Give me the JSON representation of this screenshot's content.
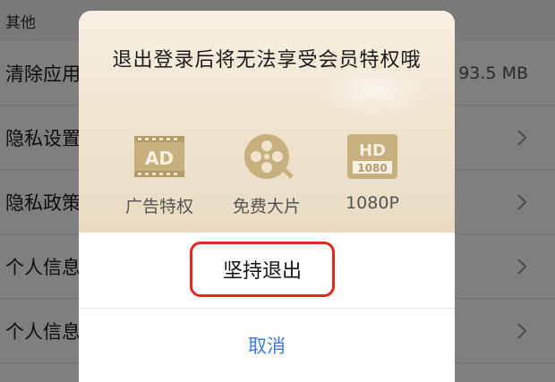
{
  "background": {
    "section_header": "其他",
    "rows": [
      {
        "label": "清除应用",
        "value": "93.5 MB"
      },
      {
        "label": "隐私设置",
        "value": ""
      },
      {
        "label": "隐私政策",
        "value": ""
      },
      {
        "label": "个人信息",
        "value": ""
      },
      {
        "label": "个人信息",
        "value": ""
      }
    ]
  },
  "dialog": {
    "title": "退出登录后将无法享受会员特权哦",
    "perks": [
      {
        "label": "广告特权",
        "icon": "ad-icon"
      },
      {
        "label": "免费大片",
        "icon": "film-reel-icon"
      },
      {
        "label": "1080P",
        "icon": "hd-1080-icon"
      }
    ],
    "confirm_label": "坚持退出",
    "cancel_label": "取消"
  },
  "colors": {
    "accent_blue": "#3a7de0",
    "highlight_red": "#e0281e",
    "gold": "#c9b48a"
  }
}
